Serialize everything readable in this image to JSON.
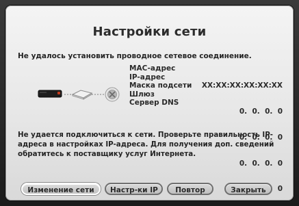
{
  "dialog": {
    "title": "Настройки сети",
    "error_line": "Не удалось установить проводное сетевое соединение.",
    "info": {
      "labels": [
        "MAC-адрес",
        "IP-адрес",
        "Маска подсети",
        "Шлюз",
        "Сервер DNS"
      ],
      "values": [
        "XX:XX:XX:XX:XX:XX",
        "0.  0.  0.  0",
        "0.  0.  0.  0",
        "0.  0.  0.  0",
        "0.  0.  0.  0"
      ]
    },
    "message": "Не удается подключиться к сети. Проверьте правильность IP-адреса в настройках IP-адреса. Для получения доп. сведений обратитесь к поставщику услуг Интернета.",
    "buttons": {
      "change_network": "Изменение сети",
      "ip_settings": "Настр-ки IP",
      "retry": "Повтор",
      "close": "Закрыть"
    },
    "diagram_icons": [
      "player-icon",
      "router-icon",
      "internet-globe-icon"
    ]
  }
}
